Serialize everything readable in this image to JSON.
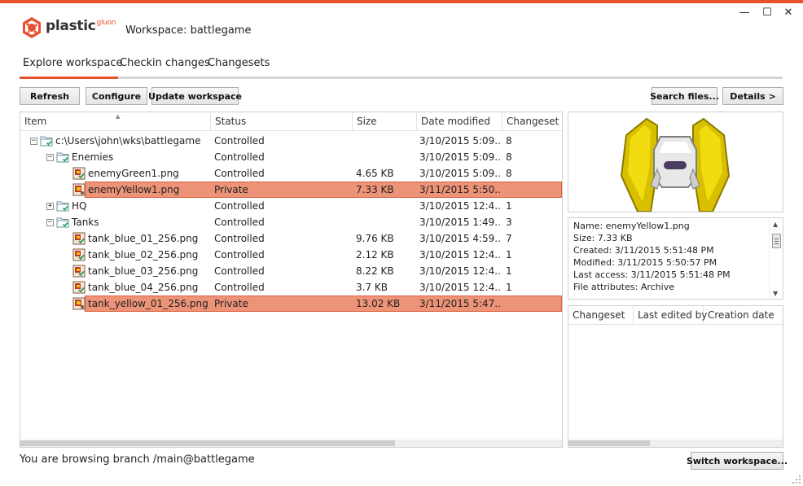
{
  "app": {
    "brand": "plastic",
    "brand_sub": "gluon",
    "workspace_title": "Workspace: battlegame",
    "accent_color": "#e8502f"
  },
  "window_controls": {
    "minimize": "—",
    "maximize": "☐",
    "close": "✕"
  },
  "tabs": [
    {
      "label": "Explore workspace",
      "active": true
    },
    {
      "label": "Checkin changes",
      "active": false
    },
    {
      "label": "Changesets",
      "active": false
    }
  ],
  "toolbar": {
    "refresh_label": "Refresh",
    "configure_label": "Configure",
    "update_label": "Update workspace",
    "search_label": "Search files...",
    "details_label": "Details >"
  },
  "filelist": {
    "columns": {
      "item": "Item",
      "status": "Status",
      "size": "Size",
      "date": "Date modified",
      "changeset": "Changeset"
    },
    "rows": [
      {
        "name": "c:\\Users\\john\\wks\\battlegame",
        "status": "Controlled",
        "size": "",
        "date": "3/10/2015 5:09...",
        "changeset": "8",
        "kind": "folder",
        "depth": 0,
        "expander": "−",
        "private": false
      },
      {
        "name": "Enemies",
        "status": "Controlled",
        "size": "",
        "date": "3/10/2015 5:09...",
        "changeset": "8",
        "kind": "folder",
        "depth": 1,
        "expander": "−",
        "private": false
      },
      {
        "name": "enemyGreen1.png",
        "status": "Controlled",
        "size": "4.65 KB",
        "date": "3/10/2015 5:09...",
        "changeset": "8",
        "kind": "file",
        "depth": 2,
        "expander": "",
        "private": false
      },
      {
        "name": "enemyYellow1.png",
        "status": "Private",
        "size": "7.33 KB",
        "date": "3/11/2015 5:50...",
        "changeset": "",
        "kind": "file",
        "depth": 2,
        "expander": "",
        "private": true
      },
      {
        "name": "HQ",
        "status": "Controlled",
        "size": "",
        "date": "3/10/2015 12:4...",
        "changeset": "1",
        "kind": "folder",
        "depth": 1,
        "expander": "+",
        "private": false
      },
      {
        "name": "Tanks",
        "status": "Controlled",
        "size": "",
        "date": "3/10/2015 1:49...",
        "changeset": "3",
        "kind": "folder",
        "depth": 1,
        "expander": "−",
        "private": false
      },
      {
        "name": "tank_blue_01_256.png",
        "status": "Controlled",
        "size": "9.76 KB",
        "date": "3/10/2015 4:59...",
        "changeset": "7",
        "kind": "file",
        "depth": 2,
        "expander": "",
        "private": false
      },
      {
        "name": "tank_blue_02_256.png",
        "status": "Controlled",
        "size": "2.12 KB",
        "date": "3/10/2015 12:4...",
        "changeset": "1",
        "kind": "file",
        "depth": 2,
        "expander": "",
        "private": false
      },
      {
        "name": "tank_blue_03_256.png",
        "status": "Controlled",
        "size": "8.22 KB",
        "date": "3/10/2015 12:4...",
        "changeset": "1",
        "kind": "file",
        "depth": 2,
        "expander": "",
        "private": false
      },
      {
        "name": "tank_blue_04_256.png",
        "status": "Controlled",
        "size": "3.7 KB",
        "date": "3/10/2015 12:4...",
        "changeset": "1",
        "kind": "file",
        "depth": 2,
        "expander": "",
        "private": false
      },
      {
        "name": "tank_yellow_01_256.png",
        "status": "Private",
        "size": "13.02 KB",
        "date": "3/11/2015 5:47...",
        "changeset": "",
        "kind": "file",
        "depth": 2,
        "expander": "",
        "private": true
      }
    ]
  },
  "details": {
    "lines": [
      "Name: enemyYellow1.png",
      "Size: 7.33 KB",
      "Created: 3/11/2015 5:51:48 PM",
      "Modified: 3/11/2015 5:50:57 PM",
      "Last access: 3/11/2015 5:51:48 PM",
      "File attributes: Archive"
    ]
  },
  "history": {
    "columns": [
      "Changeset",
      "Last edited by",
      "Creation date"
    ]
  },
  "status_bar": {
    "text": "You are browsing branch /main@battlegame",
    "switch_label": "Switch workspace..."
  }
}
